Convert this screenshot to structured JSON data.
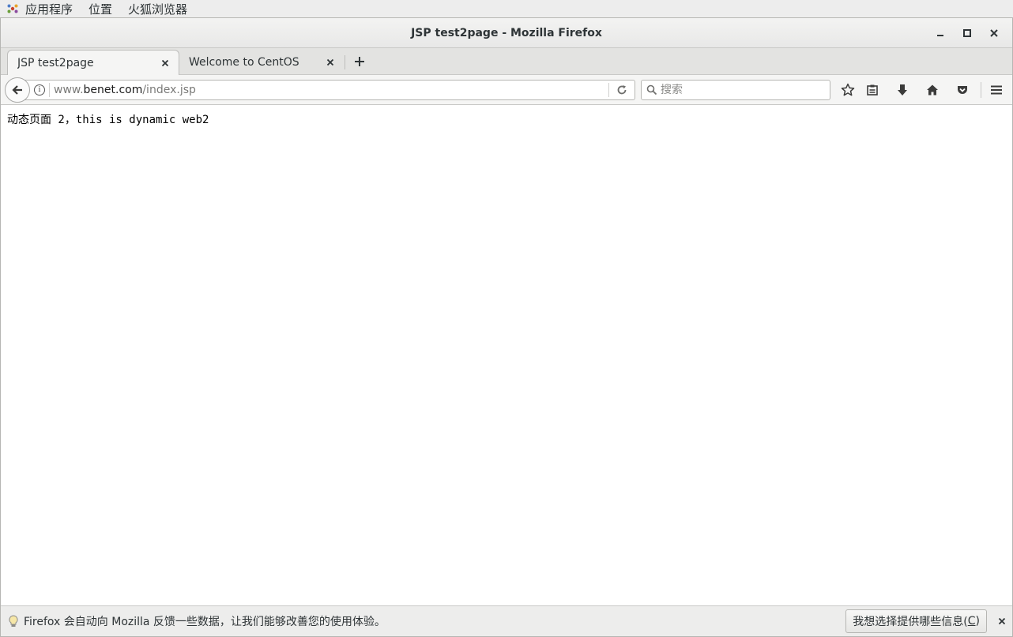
{
  "topbar": {
    "menus": [
      "应用程序",
      "位置",
      "火狐浏览器"
    ]
  },
  "window": {
    "title": "JSP test2page - Mozilla Firefox"
  },
  "tabs": [
    {
      "label": "JSP test2page",
      "active": true
    },
    {
      "label": "Welcome to CentOS",
      "active": false
    }
  ],
  "navbar": {
    "url_prefix": "www.",
    "url_host": "benet.com",
    "url_path": "/index.jsp",
    "search_placeholder": "搜索"
  },
  "icons": {
    "back": "arrow-left-icon",
    "info": "info-icon",
    "reload": "reload-icon",
    "search": "search-icon",
    "bookmark": "star-icon",
    "library": "clipboard-icon",
    "downloads": "download-arrow-icon",
    "home": "home-icon",
    "pocket": "pocket-icon",
    "menu": "hamburger-icon"
  },
  "page": {
    "text": "动态页面 2，this is dynamic web2"
  },
  "notification": {
    "message": "Firefox 会自动向 Mozilla 反馈一些数据，让我们能够改善您的使用体验。",
    "button_label": "我想选择提供哪些信息(",
    "button_accel": "C",
    "button_suffix": ")"
  },
  "colors": {
    "chrome_bg": "#f5f5f4",
    "topbar_bg": "#ededed",
    "border": "#c9c9c7"
  }
}
